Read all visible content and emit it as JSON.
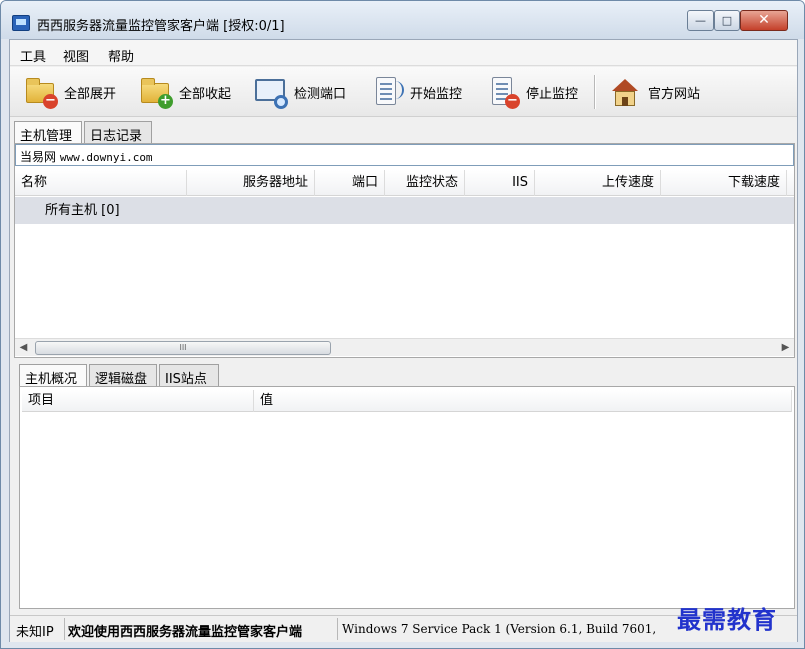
{
  "window": {
    "title": "西西服务器流量监控管家客户端 [授权:0/1]",
    "controls": {
      "minimize": "—",
      "maximize": "□",
      "close": "✕"
    }
  },
  "menu": [
    "工具",
    "视图",
    "帮助"
  ],
  "toolbar": {
    "expand_all": "全部展开",
    "collapse_all": "全部收起",
    "check_port": "检测端口",
    "start_monitor": "开始监控",
    "stop_monitor": "停止监控",
    "official_site": "官方网站"
  },
  "top_tabs": [
    "主机管理",
    "日志记录"
  ],
  "address_bar": {
    "label": "当易网",
    "url": "www.downyi.com"
  },
  "host_grid": {
    "columns": [
      "名称",
      "服务器地址",
      "端口",
      "监控状态",
      "IIS",
      "上传速度",
      "下载速度"
    ],
    "rows": [
      {
        "name": "所有主机 [0]"
      }
    ],
    "scroll_thumb": "III"
  },
  "bottom_tabs": [
    "主机概况",
    "逻辑磁盘",
    "IIS站点"
  ],
  "detail_grid": {
    "columns": [
      "项目",
      "值"
    ]
  },
  "status": {
    "ip": "未知IP",
    "welcome": "欢迎使用西西服务器流量监控管家客户端",
    "os": "Windows 7 Service Pack 1 (Version 6.1, Build 7601,"
  },
  "watermark": "最需教育"
}
